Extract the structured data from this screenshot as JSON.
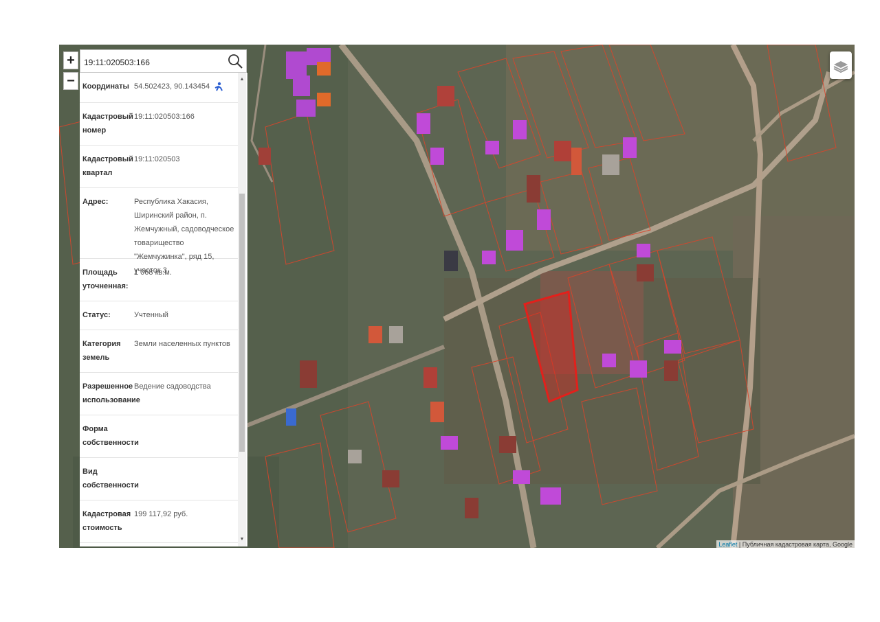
{
  "search": {
    "value": "19:11:020503:166"
  },
  "zoom": {
    "in_label": "+",
    "out_label": "−"
  },
  "info_panel": {
    "rows": [
      {
        "label": "Координаты",
        "value": "54.502423, 90.143454"
      },
      {
        "label": "Кадастровый номер",
        "value": "19:11:020503:166"
      },
      {
        "label": "Кадастровый квартал",
        "value": "19:11:020503"
      },
      {
        "label": "Адрес:",
        "value": "Республика Хакасия, Ширинский район, п. Жемчужный, садоводческое товарищество \"Жемчужинка\", ряд 15, участок 3"
      },
      {
        "label": "Площадь уточненная:",
        "value": "1 068 кв.м."
      },
      {
        "label": "Статус:",
        "value": "Учтенный"
      },
      {
        "label": "Категория земель",
        "value": "Земли населенных пунктов"
      },
      {
        "label": "Разрешенное использование",
        "value": "Ведение садоводства"
      },
      {
        "label": "Форма собственности",
        "value": ""
      },
      {
        "label": "Вид собственности",
        "value": ""
      },
      {
        "label": "Кадастровая стоимость",
        "value": "199 117,92 руб."
      }
    ]
  },
  "attribution": {
    "link": "Leaflet",
    "text": " | Публичная кадастровая карта, Google"
  },
  "colors": {
    "selected_parcel": "#e3201b",
    "parcel_border": "#d9452b",
    "building_highlight": "#c04ad8",
    "road": "#b39f8a"
  },
  "icons": {
    "search": "search-icon",
    "layers": "layers-icon",
    "coordinates": "person-icon"
  }
}
